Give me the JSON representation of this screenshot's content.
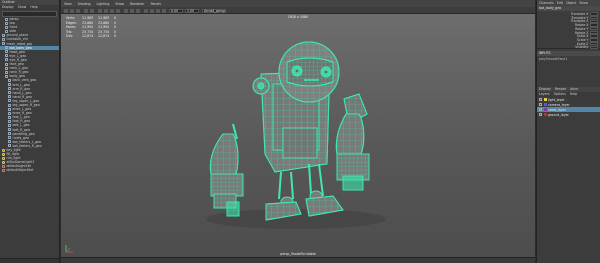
{
  "outliner": {
    "title": "Outliner",
    "menu": [
      "Display",
      "Show",
      "Help"
    ],
    "items": [
      {
        "label": "persp",
        "indent": 1,
        "icon": "camera-icon"
      },
      {
        "label": "top",
        "indent": 1,
        "icon": "camera-icon"
      },
      {
        "label": "front",
        "indent": 1,
        "icon": "camera-icon"
      },
      {
        "label": "side",
        "indent": 1,
        "icon": "camera-icon"
      },
      {
        "label": "ground_plane",
        "indent": 0,
        "icon": "mesh-icon"
      },
      {
        "label": "turntable_ctrl",
        "indent": 0,
        "icon": "mesh-icon"
      },
      {
        "label": "mesh_robot_grp",
        "indent": 0,
        "icon": "group-icon"
      },
      {
        "label": "bot_body_geo",
        "indent": 1,
        "icon": "mesh-icon",
        "selected": true
      },
      {
        "label": "head_geo",
        "indent": 1,
        "icon": "mesh-icon"
      },
      {
        "label": "eye_L_geo",
        "indent": 1,
        "icon": "mesh-icon"
      },
      {
        "label": "eye_R_geo",
        "indent": 1,
        "icon": "mesh-icon"
      },
      {
        "label": "face_geo",
        "indent": 1,
        "icon": "mesh-icon"
      },
      {
        "label": "neck_L_geo",
        "indent": 1,
        "icon": "mesh-icon"
      },
      {
        "label": "neck_R_geo",
        "indent": 1,
        "icon": "mesh-icon"
      },
      {
        "label": "body_geo",
        "indent": 1,
        "icon": "mesh-icon"
      },
      {
        "label": "back_vent_geo",
        "indent": 2,
        "icon": "mesh-icon"
      },
      {
        "label": "arm_L_geo",
        "indent": 2,
        "icon": "mesh-icon"
      },
      {
        "label": "arm_R_geo",
        "indent": 2,
        "icon": "mesh-icon"
      },
      {
        "label": "hand_L_geo",
        "indent": 2,
        "icon": "mesh-icon"
      },
      {
        "label": "hand_R_geo",
        "indent": 2,
        "icon": "mesh-icon"
      },
      {
        "label": "leg_upper_L_geo",
        "indent": 2,
        "icon": "mesh-icon"
      },
      {
        "label": "leg_upper_R_geo",
        "indent": 2,
        "icon": "mesh-icon"
      },
      {
        "label": "knee_L_geo",
        "indent": 2,
        "icon": "mesh-icon"
      },
      {
        "label": "knee_R_geo",
        "indent": 2,
        "icon": "mesh-icon"
      },
      {
        "label": "foot_L_geo",
        "indent": 2,
        "icon": "mesh-icon"
      },
      {
        "label": "foot_R_geo",
        "indent": 2,
        "icon": "mesh-icon"
      },
      {
        "label": "bolt_L_geo",
        "indent": 2,
        "icon": "mesh-icon"
      },
      {
        "label": "bolt_R_geo",
        "indent": 2,
        "icon": "mesh-icon"
      },
      {
        "label": "panelling_geo",
        "indent": 2,
        "icon": "mesh-icon"
      },
      {
        "label": "rivets_geo",
        "indent": 2,
        "icon": "mesh-icon"
      },
      {
        "label": "bot_feelers_L_geo",
        "indent": 2,
        "icon": "mesh-icon"
      },
      {
        "label": "bot_feelers_R_geo",
        "indent": 2,
        "icon": "mesh-icon"
      },
      {
        "label": "key_light",
        "indent": 0,
        "icon": "light-icon"
      },
      {
        "label": "fill_light",
        "indent": 0,
        "icon": "light-icon"
      },
      {
        "label": "rim_light",
        "indent": 0,
        "icon": "light-icon"
      },
      {
        "label": "aiSkyDomeLight1",
        "indent": 0,
        "icon": "light-icon"
      },
      {
        "label": "defaultLightSet",
        "indent": 0,
        "icon": "set-icon"
      },
      {
        "label": "defaultObjectSet",
        "indent": 0,
        "icon": "set-icon"
      }
    ]
  },
  "viewport": {
    "menu": [
      "View",
      "Shading",
      "Lighting",
      "Show",
      "Renderer",
      "Panels"
    ],
    "camera_field": "Arnold_persp",
    "toolbar_value_a": "0.00",
    "toolbar_value_b": "1.00",
    "center_label": "1920 x 1080",
    "hud": [
      [
        "Verts:",
        "11,983",
        "11,983",
        "0"
      ],
      [
        "Edges:",
        "23,880",
        "23,880",
        "0"
      ],
      [
        "Faces:",
        "11,992",
        "11,992",
        "0"
      ],
      [
        "Tris:",
        "23,734",
        "23,734",
        "0"
      ],
      [
        "UVs:",
        "12,874",
        "12,874",
        "0"
      ]
    ],
    "bottom_label": "persp_ShadeTurntable",
    "wire_color": "#3ee8b0"
  },
  "right_panel": {
    "tabs": [
      "Channels",
      "Edit",
      "Object",
      "Show"
    ],
    "object_name": "bot_body_geo",
    "attributes": [
      "Translate X",
      "Translate Y",
      "Translate Z",
      "Rotate X",
      "Rotate Y",
      "Rotate Z",
      "Scale X",
      "Scale Y",
      "Scale Z",
      "Visibility"
    ],
    "inputs_title": "INPUTS",
    "inputs_sub": "polySmoothFace1",
    "display_tabs": [
      "Display",
      "Render",
      "Anim"
    ],
    "display_menu": [
      "Layers",
      "Options",
      "Help"
    ],
    "layers": [
      {
        "name": "light_layer",
        "color": "#e6d24a"
      },
      {
        "name": "camera_layer",
        "color": "#4a5fe0"
      },
      {
        "name": "robot_layer",
        "color": "#7a3fa0",
        "selected": true
      },
      {
        "name": "ground_layer",
        "color": "#c13030"
      }
    ]
  }
}
